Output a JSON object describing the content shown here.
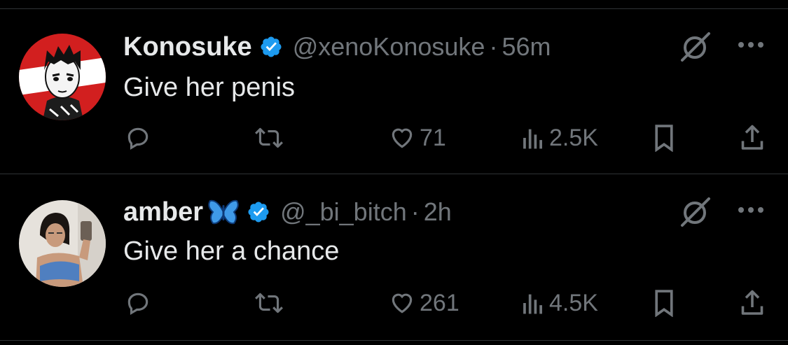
{
  "tweets": [
    {
      "name": "Konosuke",
      "handle": "@xenoKonosuke",
      "separator": "·",
      "time": "56m",
      "text": "Give her penis",
      "likes": "71",
      "views": "2.5K",
      "verified": true
    },
    {
      "name": "amber",
      "name_emoji": "butterfly-emoji",
      "handle": "@_bi_bitch",
      "separator": "·",
      "time": "2h",
      "text": "Give her a chance",
      "likes": "261",
      "views": "4.5K",
      "verified": true
    }
  ],
  "icons": {
    "verified": "verified-badge-icon",
    "grok": "grok-icon",
    "more": "more-dots-icon",
    "reply": "reply-icon",
    "retweet": "retweet-icon",
    "like": "like-icon",
    "views": "views-icon",
    "bookmark": "bookmark-icon",
    "share": "share-icon"
  },
  "colors": {
    "background": "#000000",
    "text": "#e7e9ea",
    "secondary": "#71767b",
    "verified": "#1d9bf0",
    "divider": "#2f3336"
  }
}
